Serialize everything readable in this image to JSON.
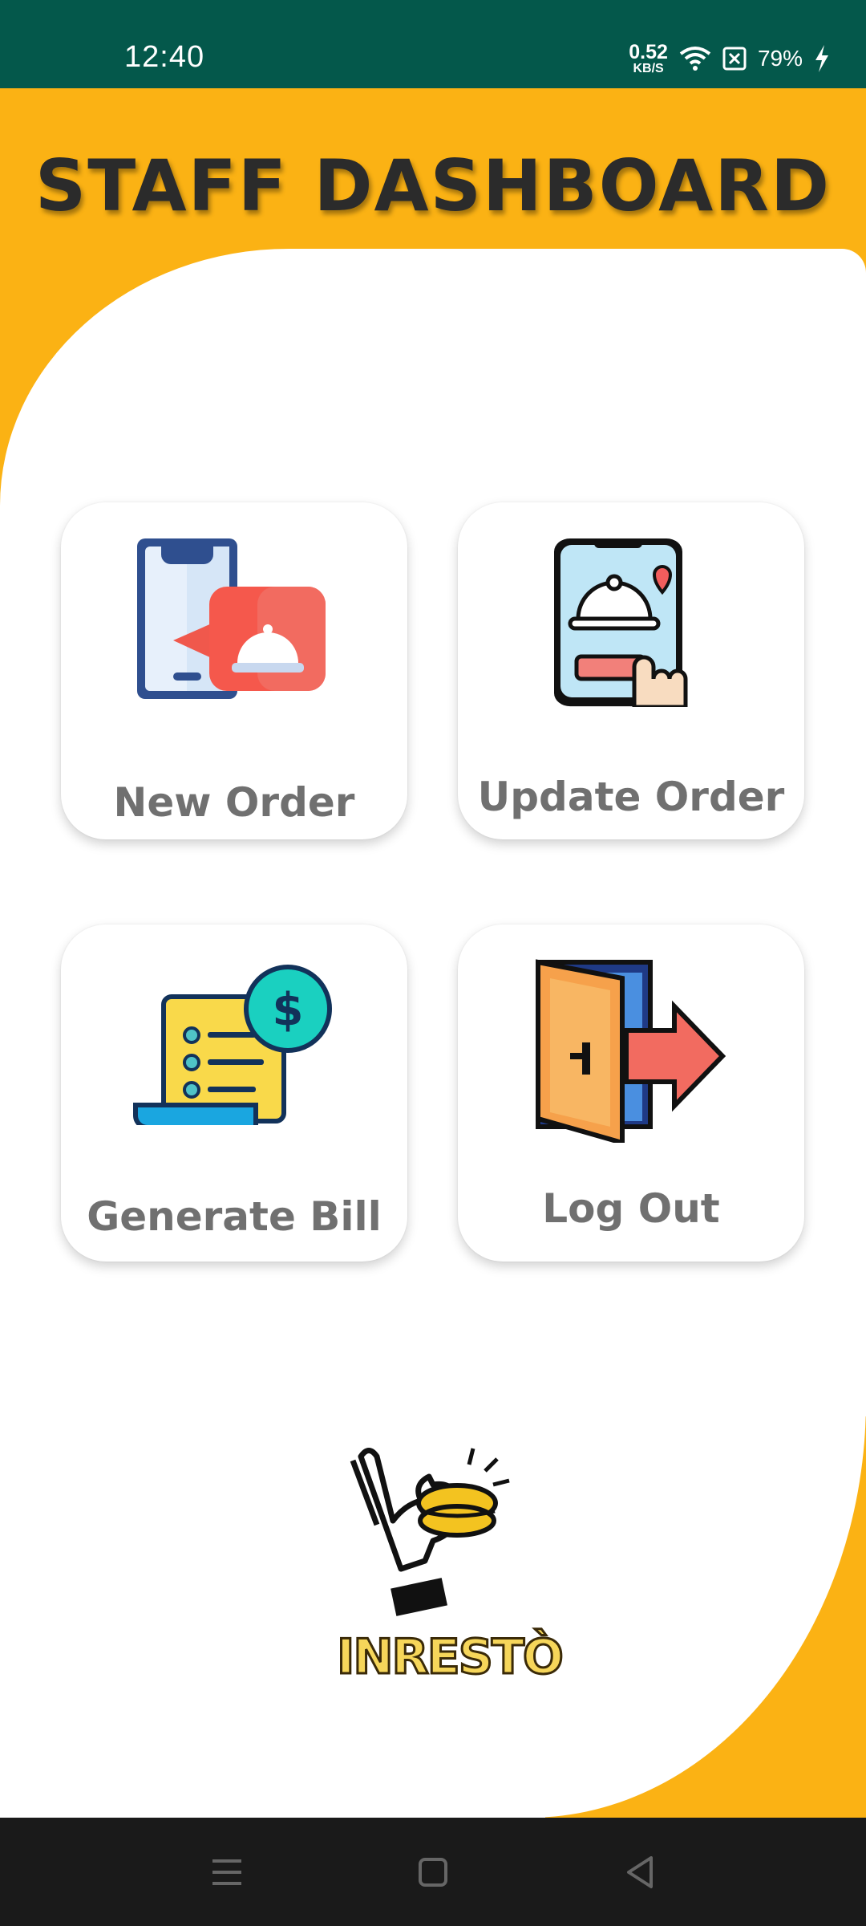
{
  "status_bar": {
    "time": "12:40",
    "net_speed_value": "0.52",
    "net_speed_unit": "KB/S",
    "battery": "79%",
    "icons": [
      "wifi-icon",
      "no-sim-icon",
      "charging-bolt-icon"
    ]
  },
  "page": {
    "title": "STAFF DASHBOARD"
  },
  "cards": [
    {
      "label": "New Order",
      "icon": "new-order-phone-icon"
    },
    {
      "label": "Update Order",
      "icon": "update-order-phone-icon"
    },
    {
      "label": "Generate Bill",
      "icon": "bill-receipt-icon"
    },
    {
      "label": "Log Out",
      "icon": "logout-door-icon"
    }
  ],
  "logo": {
    "text": "INRESTÒ"
  },
  "nav_bar": {
    "buttons": [
      "menu-icon",
      "home-icon",
      "back-icon"
    ]
  },
  "colors": {
    "status_bar": "#04584b",
    "accent_yellow": "#fbb214",
    "card_label": "#707070",
    "nav_bar": "#1a1a1a"
  }
}
